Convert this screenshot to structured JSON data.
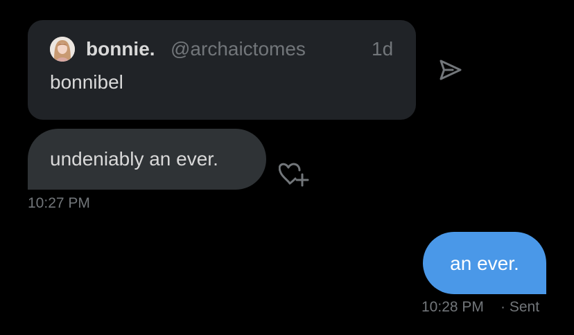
{
  "quoted_tweet": {
    "display_name": "bonnie.",
    "handle": "@archaictomes",
    "time": "1d",
    "text": "bonnibel",
    "avatar_icon": "avatar-portrait"
  },
  "received_message": {
    "text": "undeniably an ever.",
    "time": "10:27 PM",
    "reaction_icon": "heart-plus-icon"
  },
  "sent_message": {
    "text": "an ever.",
    "time": "10:28 PM",
    "status": "· Sent"
  },
  "share_icon": "send-icon",
  "colors": {
    "background": "#000000",
    "quoted_card": "#202327",
    "received_bubble": "#2f3336",
    "sent_bubble": "#4a98e8",
    "primary_text": "#d9d9d9",
    "secondary_text": "#72767a",
    "sent_text": "#ffffff"
  }
}
